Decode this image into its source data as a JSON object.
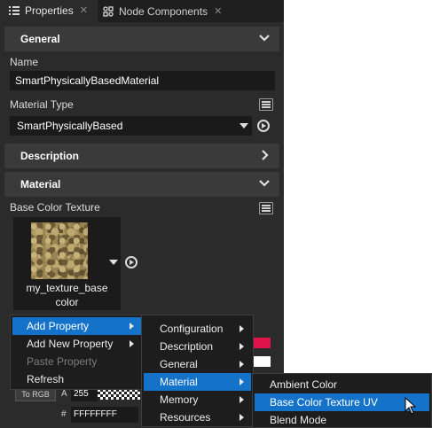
{
  "tabs": [
    {
      "label": "Properties",
      "close": "✕",
      "icon": "list-icon"
    },
    {
      "label": "Node Components",
      "close": "✕",
      "icon": "components-icon"
    }
  ],
  "sections": {
    "general": "General",
    "description": "Description",
    "material": "Material"
  },
  "fields": {
    "name_label": "Name",
    "name_value": "SmartPhysicallyBasedMaterial",
    "material_type_label": "Material Type",
    "material_type_value": "SmartPhysicallyBased",
    "base_color_texture_label": "Base Color Texture",
    "texture_name": "my_texture_basecolor"
  },
  "color_row": {
    "to_rgb": "To RGB",
    "alpha_label": "A",
    "alpha_value": "255",
    "hex_label": "#",
    "hex_value": "FFFFFFFF"
  },
  "context_menu": [
    {
      "label": "Add Property",
      "has_submenu": true,
      "highlighted": true
    },
    {
      "label": "Add New Property",
      "has_submenu": true
    },
    {
      "label": "Paste Property",
      "disabled": true
    },
    {
      "label": "Refresh"
    }
  ],
  "submenu_categories": [
    {
      "label": "Configuration"
    },
    {
      "label": "Description"
    },
    {
      "label": "General"
    },
    {
      "label": "Material",
      "highlighted": true
    },
    {
      "label": "Memory"
    },
    {
      "label": "Resources"
    }
  ],
  "submenu_material": [
    {
      "label": "Ambient Color"
    },
    {
      "label": "Base Color Texture UV",
      "highlighted": true
    },
    {
      "label": "Blend Mode"
    }
  ],
  "colors": {
    "panel_bg": "#2b2b2b",
    "section_bg": "#3a3a3a",
    "highlight": "#1473c8",
    "swatch_red": "#e0134a"
  }
}
